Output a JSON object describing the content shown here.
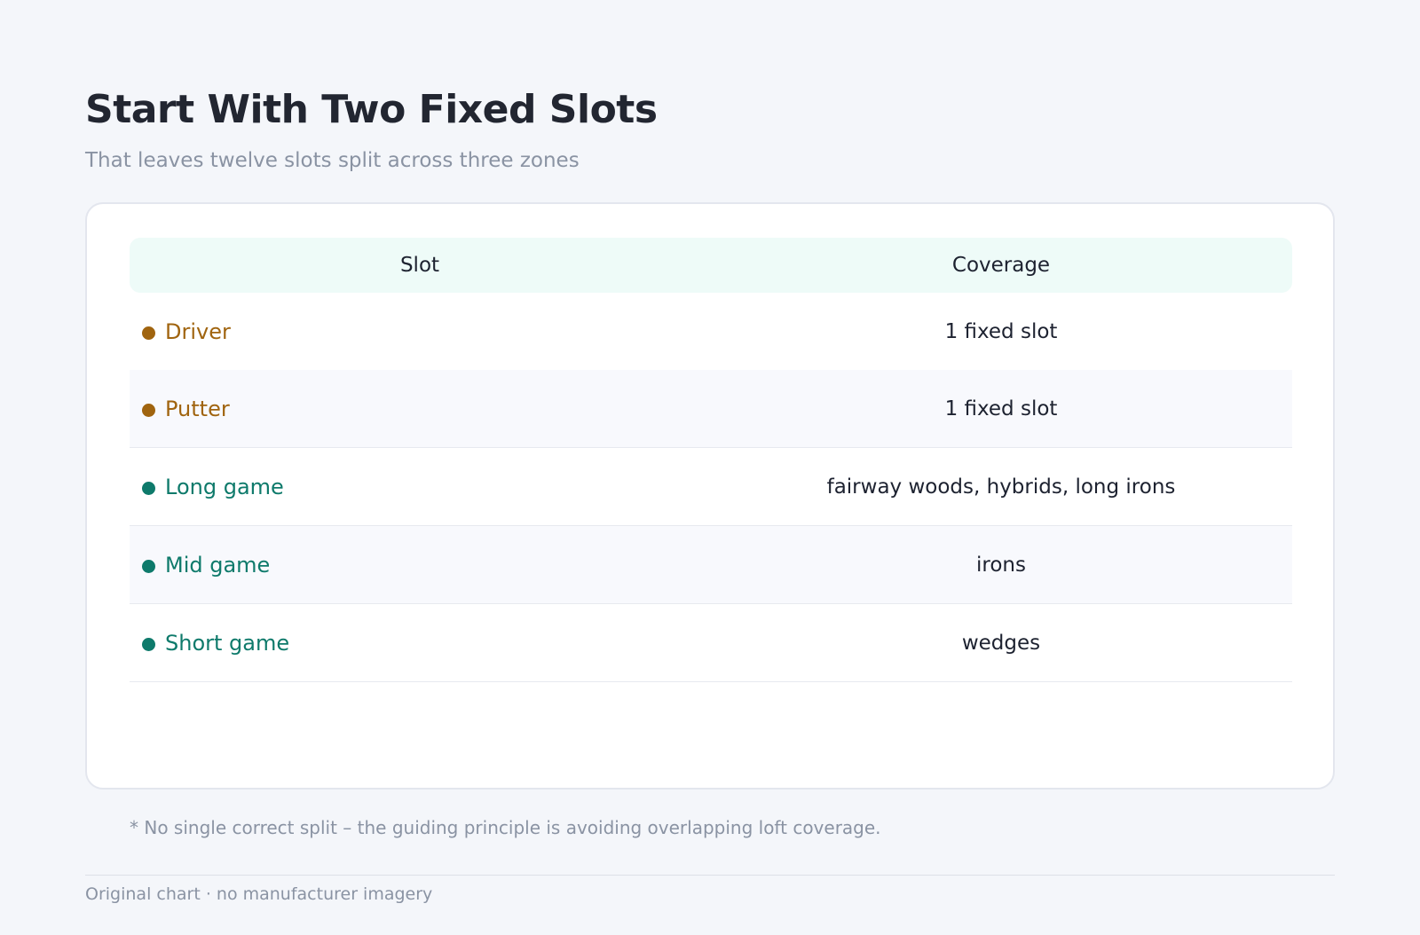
{
  "title": "Start With Two Fixed Slots",
  "subtitle": "That leaves twelve slots split across three zones",
  "chart_data": {
    "type": "table",
    "columns": [
      "Slot",
      "Coverage"
    ],
    "rows": [
      {
        "slot": "Driver",
        "coverage": "1 fixed slot",
        "group": "fixed",
        "color": "#a0640f"
      },
      {
        "slot": "Putter",
        "coverage": "1 fixed slot",
        "group": "fixed",
        "color": "#a0640f"
      },
      {
        "slot": "Long game",
        "coverage": "fairway woods, hybrids, long irons",
        "group": "zone",
        "color": "#0e7a6b"
      },
      {
        "slot": "Mid game",
        "coverage": "irons",
        "group": "zone",
        "color": "#0e7a6b"
      },
      {
        "slot": "Short game",
        "coverage": "wedges",
        "group": "zone",
        "color": "#0e7a6b"
      }
    ]
  },
  "footnote": "* No single correct split – the guiding principle is avoiding overlapping loft coverage.",
  "source": "Original chart · no manufacturer imagery",
  "colors": {
    "fixed": "#a0640f",
    "zone": "#0e7a6b",
    "header_bg": "#eefbf8"
  }
}
